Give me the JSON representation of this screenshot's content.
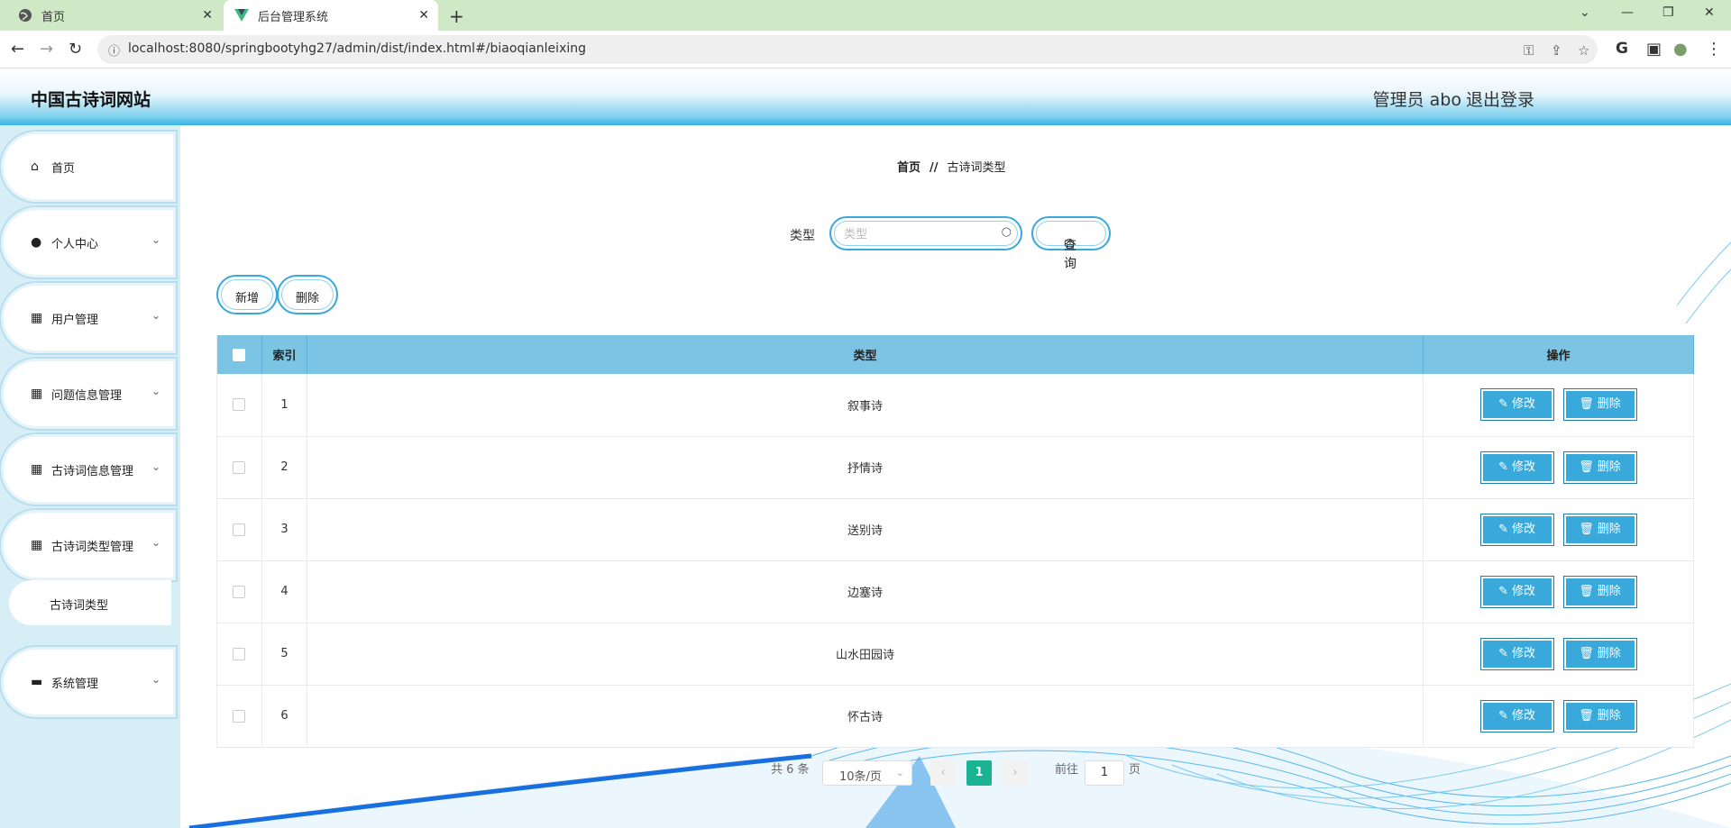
{
  "browser": {
    "tabs": [
      {
        "label": "首页"
      },
      {
        "label": "后台管理系统"
      }
    ],
    "url": "localhost:8080/springbootyhg27/admin/dist/index.html#/biaoqianleixing"
  },
  "header": {
    "title": "中国古诗词网站",
    "admin": "管理员 abo",
    "logout": "退出登录"
  },
  "sidebar": {
    "items": [
      {
        "label": "首页",
        "icon": "home-icon"
      },
      {
        "label": "个人中心",
        "icon": "user-icon"
      },
      {
        "label": "用户管理",
        "icon": "grid-icon"
      },
      {
        "label": "问题信息管理",
        "icon": "grid-icon"
      },
      {
        "label": "古诗词信息管理",
        "icon": "grid-icon"
      },
      {
        "label": "古诗词类型管理",
        "icon": "grid-icon"
      },
      {
        "label": "系统管理",
        "icon": "monitor-icon"
      }
    ],
    "submenu": {
      "label": "古诗词类型"
    }
  },
  "breadcrumb": {
    "home": "首页",
    "separator": "//",
    "current": "古诗词类型"
  },
  "search": {
    "label": "类型",
    "placeholder": "类型",
    "button": "查询"
  },
  "actions": {
    "add": "新增",
    "delete": "删除"
  },
  "table": {
    "headers": {
      "index": "索引",
      "type": "类型",
      "ops": "操作"
    },
    "rows": [
      {
        "index": "1",
        "type": "叙事诗"
      },
      {
        "index": "2",
        "type": "抒情诗"
      },
      {
        "index": "3",
        "type": "送别诗"
      },
      {
        "index": "4",
        "type": "边塞诗"
      },
      {
        "index": "5",
        "type": "山水田园诗"
      },
      {
        "index": "6",
        "type": "怀古诗"
      }
    ],
    "edit_label": "修改",
    "delete_label": "删除"
  },
  "pagination": {
    "total": "共 6 条",
    "page_size": "10条/页",
    "current": "1",
    "goto_prefix": "前往",
    "goto_value": "1",
    "goto_suffix": "页"
  },
  "colors": {
    "accent": "#39a9dc",
    "header_blue": "#36b3e4",
    "table_header": "#7cc4e3",
    "page_active": "#1ab394"
  }
}
